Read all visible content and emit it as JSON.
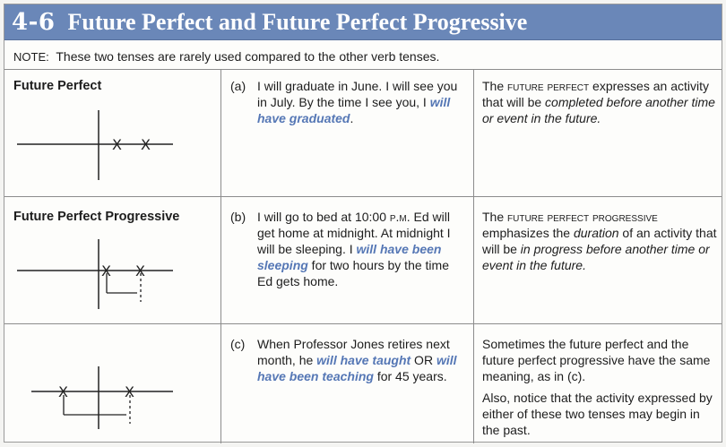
{
  "header": {
    "number": "4-6",
    "title": "Future Perfect and Future Perfect Progressive"
  },
  "note": {
    "label": "NOTE:",
    "text": "These two tenses are rarely used compared to the other verb tenses."
  },
  "rows": [
    {
      "title": "Future Perfect",
      "label": "(a)",
      "example_parts": [
        "I will graduate in June. I will see you in July. By the time I see you, I ",
        "will have graduated",
        "."
      ],
      "explanation_parts": [
        "The ",
        "future perfect",
        " expresses an activity that will be ",
        "completed before another time or event in the future."
      ]
    },
    {
      "title": "Future Perfect Progressive",
      "label": "(b)",
      "example_parts": [
        "I will go to bed at 10:00 ",
        "p.m.",
        " Ed will get home at midnight. At midnight I will be sleeping. I ",
        "will have been sleeping",
        " for two hours by the time Ed gets home."
      ],
      "explanation_parts": [
        "The ",
        "future perfect progressive",
        " emphasizes the ",
        "duration",
        " of an activity that will be ",
        "in progress before another time or event in the future."
      ]
    },
    {
      "title": "",
      "label": "(c)",
      "example_parts": [
        "When Professor Jones retires next month, he ",
        "will have taught",
        " OR ",
        "will have been teaching",
        " for 45 years."
      ],
      "explanation_p1": "Sometimes the future perfect and the future perfect progressive have the same meaning, as in (c).",
      "explanation_p2": "Also, notice that the activity expressed by either of these two tenses may begin in the past."
    }
  ],
  "colors": {
    "header": "#6a87b8",
    "highlight": "#5577b5"
  }
}
